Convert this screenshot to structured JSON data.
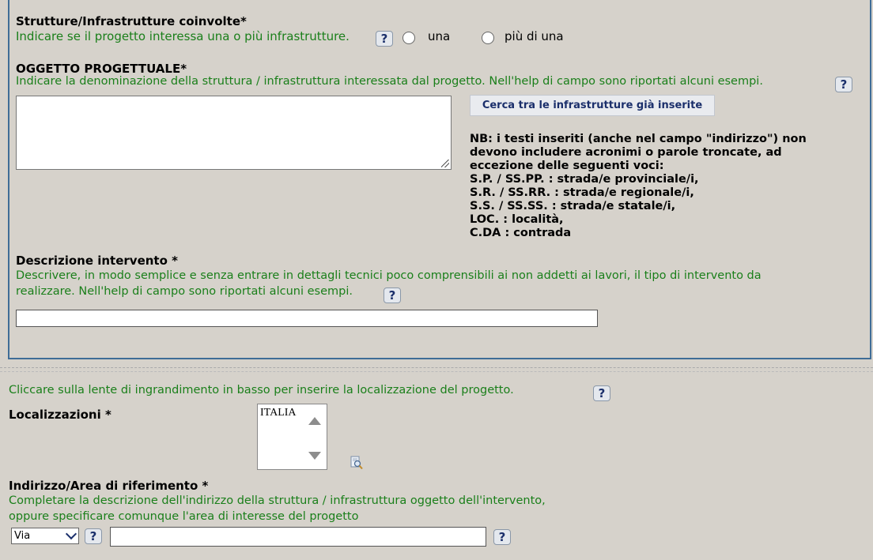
{
  "section1": {
    "strutture_title": "Strutture/Infrastrutture coinvolte*",
    "strutture_hint": "Indicare se il progetto interessa una o più infrastrutture.",
    "radio_una": "una",
    "radio_piu": "più di una",
    "oggetto_title": "OGGETTO PROGETTUALE*",
    "oggetto_hint": "Indicare la denominazione della struttura / infrastruttura interessata dal progetto. Nell'help di campo sono riportati alcuni esempi.",
    "cerca_button": "Cerca tra le infrastrutture già inserite",
    "nb_lines": [
      "NB: i testi inseriti (anche nel campo \"indirizzo\") non",
      "devono includere acronimi o parole troncate, ad",
      "eccezione delle seguenti voci:",
      "S.P. / SS.PP. : strada/e provinciale/i,",
      "S.R. / SS.RR. : strada/e regionale/i,",
      "S.S. / SS.SS. : strada/e statale/i,",
      "LOC. : località,",
      "C.DA : contrada"
    ],
    "descrizione_title": "Descrizione intervento *",
    "descrizione_hint_1": "Descrivere, in modo semplice e senza entrare in dettagli tecnici poco comprensibili ai non addetti ai lavori, il tipo di intervento da",
    "descrizione_hint_2": "realizzare. Nell'help di campo sono riportati alcuni esempi."
  },
  "section2": {
    "lente_hint": "Cliccare sulla lente di ingrandimento in basso per inserire la localizzazione del progetto.",
    "localizzazioni_label": "Localizzazioni *",
    "localizzazioni_items": [
      "ITALIA"
    ],
    "indirizzo_title": "Indirizzo/Area di riferimento *",
    "indirizzo_hint_1": "Completare la descrizione dell'indirizzo della struttura / infrastruttura oggetto dell'intervento,",
    "indirizzo_hint_2": "oppure specificare comunque l'area di interesse del progetto",
    "via_select": "Via"
  },
  "help_glyph": "?",
  "colors": {
    "background": "#d6d2cb",
    "hint_green": "#1a7f1a",
    "panel_border": "#3f6d97",
    "button_text": "#1b2f6b"
  }
}
